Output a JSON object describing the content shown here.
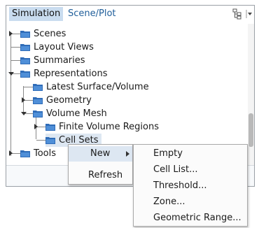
{
  "tabs": {
    "simulation": "Simulation",
    "scene_plot": "Scene/Plot"
  },
  "toolbar": {
    "tree_options_icon": "tree-view-icon",
    "dropdown_icon": "chevron-down-icon"
  },
  "tree": {
    "scenes": "Scenes",
    "layout_views": "Layout Views",
    "summaries": "Summaries",
    "representations": "Representations",
    "latest_surface_volume": "Latest Surface/Volume",
    "geometry": "Geometry",
    "volume_mesh": "Volume Mesh",
    "finite_volume_regions": "Finite Volume Regions",
    "cell_sets": "Cell Sets",
    "tools": "Tools"
  },
  "context_menu": {
    "new": "New",
    "refresh": "Refresh"
  },
  "submenu": {
    "empty": "Empty",
    "cell_list": "Cell List...",
    "threshold": "Threshold...",
    "zone": "Zone...",
    "geometric_range": "Geometric Range..."
  },
  "colors": {
    "folder": "#2f6cb8",
    "selected_tab": "#c9dcef",
    "selected_item": "#dde7f2",
    "link_tab": "#1f5e9a"
  }
}
